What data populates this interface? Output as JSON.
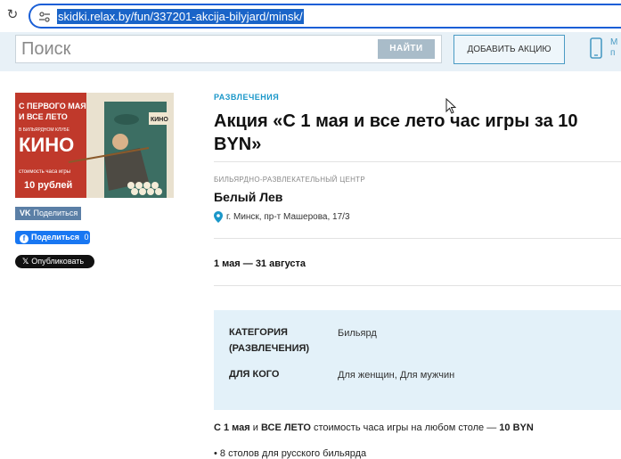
{
  "browser": {
    "url": "skidki.relax.by/fun/337201-akcija-bilyjard/minsk/"
  },
  "header": {
    "search_placeholder": "Поиск",
    "search_button": "НАЙТИ",
    "add_button": "ДОБАВИТЬ АКЦИЮ",
    "truncated_text": "М\nп"
  },
  "poster": {
    "line1": "С ПЕРВОГО МАЯ",
    "line2": "И ВСЕ ЛЕТО",
    "line3": "В БИЛЬЯРДНОМ КЛУБЕ",
    "brand": "КИНО",
    "line4": "стоимость часа игры",
    "price": "10 рублей",
    "sign": "КИНО"
  },
  "share": {
    "vk": "Поделиться",
    "fb": "Поделиться",
    "fb_count": "0",
    "x": "Опубликовать"
  },
  "offer": {
    "category_link": "РАЗВЛЕЧЕНИЯ",
    "title": "Акция «С 1 мая и все лето час игры за 10 BYN»",
    "org_type": "БИЛЬЯРДНО-РАЗВЛЕКАТЕЛЬНЫЙ ЦЕНТР",
    "org_name": "Белый Лев",
    "address": "г. Минск, пр-т Машерова, 17/3",
    "dates": "1 мая — 31 августа"
  },
  "details": {
    "category_label_1": "КАТЕГОРИЯ",
    "category_label_2": "(РАЗВЛЕЧЕНИЯ)",
    "category_value": "Бильярд",
    "audience_label": "ДЛЯ КОГО",
    "audience_value": "Для женщин, Для мужчин"
  },
  "description": {
    "bold1": "С 1 мая",
    "and": " и ",
    "bold2": "ВСЕ ЛЕТО",
    "text": " стоимость часа игры на любом столе — ",
    "bold3": "10 BYN",
    "bullet": "• 8 столов для русского бильярда"
  },
  "colors": {
    "accent": "#1a97c9",
    "header_bg": "#e8f1f7",
    "info_bg": "#e3f1f9",
    "url_highlight": "#1a64c8"
  }
}
